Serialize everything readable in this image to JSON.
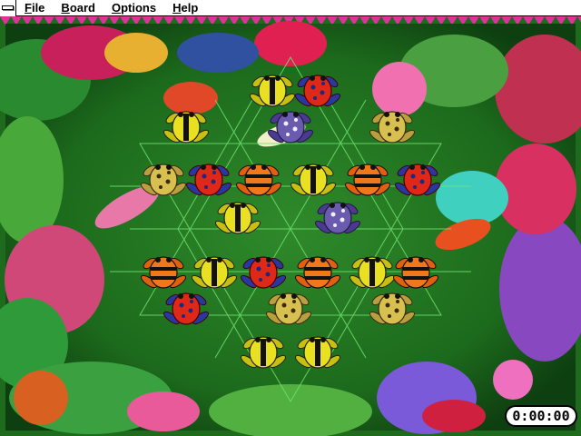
{
  "menu": {
    "system_icon": "system-menu-icon",
    "items": [
      {
        "label": "File",
        "accel": "F",
        "rest": "ile"
      },
      {
        "label": "Board",
        "accel": "B",
        "rest": "oard"
      },
      {
        "label": "Options",
        "accel": "O",
        "rest": "ptions"
      },
      {
        "label": "Help",
        "accel": "H",
        "rest": "elp"
      }
    ]
  },
  "timer": {
    "value": "0:00:00"
  },
  "board": {
    "shape": "hexagram",
    "frogs": [
      {
        "kind": "yellow-black",
        "row": 0,
        "col": 0
      },
      {
        "kind": "red-blue",
        "row": 0,
        "col": 1
      },
      {
        "kind": "yellow-black",
        "row": 1,
        "col": 0
      },
      {
        "kind": "purple",
        "row": 1,
        "col": 1
      },
      {
        "kind": "tan-spotted",
        "row": 1,
        "col": 2
      },
      {
        "kind": "tan-spotted",
        "row": 2,
        "col": 0
      },
      {
        "kind": "red-blue",
        "row": 2,
        "col": 1
      },
      {
        "kind": "orange-black",
        "row": 2,
        "col": 2
      },
      {
        "kind": "yellow-black",
        "row": 2,
        "col": 3
      },
      {
        "kind": "orange-black",
        "row": 2,
        "col": 4
      },
      {
        "kind": "red-blue",
        "row": 2,
        "col": 5
      },
      {
        "kind": "yellow-black",
        "row": 3,
        "col": 0
      },
      {
        "kind": "purple",
        "row": 3,
        "col": 1
      },
      {
        "kind": "orange-black",
        "row": 4,
        "col": 0
      },
      {
        "kind": "yellow-black",
        "row": 4,
        "col": 1
      },
      {
        "kind": "red-blue",
        "row": 4,
        "col": 2
      },
      {
        "kind": "orange-black",
        "row": 4,
        "col": 3
      },
      {
        "kind": "yellow-black",
        "row": 4,
        "col": 4
      },
      {
        "kind": "orange-black",
        "row": 4,
        "col": 5
      },
      {
        "kind": "red-blue",
        "row": 5,
        "col": 0
      },
      {
        "kind": "tan-spotted",
        "row": 5,
        "col": 1
      },
      {
        "kind": "tan-spotted",
        "row": 5,
        "col": 2
      },
      {
        "kind": "yellow-black",
        "row": 6,
        "col": 0
      },
      {
        "kind": "yellow-black",
        "row": 6,
        "col": 1
      }
    ]
  },
  "colors": {
    "felt": "#1f6e1f",
    "grid": "#6fe36f",
    "border_pink": "#e0309a",
    "border_green": "#1e6b1e"
  }
}
